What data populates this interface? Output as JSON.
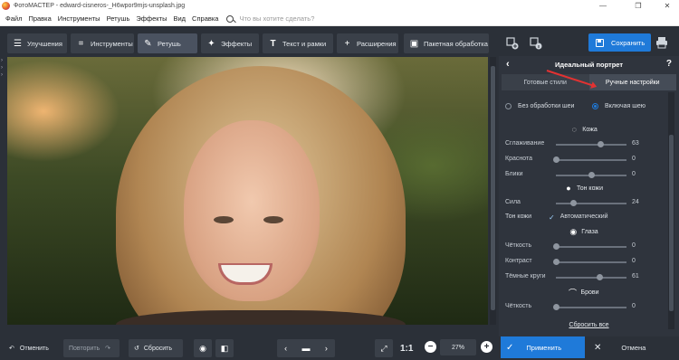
{
  "window": {
    "title": "ФотоМАСТЕР - edward-cisneros-_H6wpor9mjs-unsplash.jpg",
    "controls": [
      "—",
      "❐",
      "✕"
    ]
  },
  "menu": {
    "items": [
      "Файл",
      "Правка",
      "Инструменты",
      "Ретушь",
      "Эффекты",
      "Вид",
      "Справка"
    ],
    "search_placeholder": "Что вы хотите сделать?"
  },
  "toolbar": {
    "tabs": [
      {
        "label": "Улучшения",
        "icon": "sliders-icon"
      },
      {
        "label": "Инструменты",
        "icon": "crop-icon"
      },
      {
        "label": "Ретушь",
        "icon": "brush-icon",
        "active": true
      },
      {
        "label": "Эффекты",
        "icon": "sparkle-icon"
      },
      {
        "label": "Текст и рамки",
        "icon": "text-icon"
      },
      {
        "label": "Расширения",
        "icon": "plus-icon"
      },
      {
        "label": "Пакетная обработка",
        "icon": "batch-icon"
      }
    ],
    "save_label": "Сохранить"
  },
  "panel": {
    "title": "Идеальный портрет",
    "tabs": [
      {
        "label": "Готовые стили"
      },
      {
        "label": "Ручные настройки",
        "active": true
      }
    ],
    "radio_none": "Без обработки шеи",
    "radio_include": "Включая шею",
    "sections": {
      "skin": "Кожа",
      "skin_tone": "Тон кожи",
      "eyes": "Глаза",
      "brows": "Брови"
    },
    "sliders": {
      "smoothing": {
        "label": "Сглаживание",
        "value": "63",
        "pos": 0.63
      },
      "redness": {
        "label": "Краснота",
        "value": "0",
        "pos": 0.0
      },
      "glare": {
        "label": "Блики",
        "value": "0",
        "pos": 0.5
      },
      "strength": {
        "label": "Сила",
        "value": "24",
        "pos": 0.24
      },
      "clarity_eyes": {
        "label": "Чёткость",
        "value": "0",
        "pos": 0.0
      },
      "contrast": {
        "label": "Контраст",
        "value": "0",
        "pos": 0.0
      },
      "dark_circles": {
        "label": "Тёмные круги",
        "value": "61",
        "pos": 0.61
      },
      "clarity_brows": {
        "label": "Чёткость",
        "value": "0",
        "pos": 0.0
      }
    },
    "skin_tone_label": "Тон кожи",
    "auto_label": "Автоматический",
    "reset_all": "Сбросить все"
  },
  "bottom": {
    "undo": "Отменить",
    "redo": "Повторить",
    "reset": "Сбросить",
    "ratio": "1:1",
    "zoom": "27%",
    "apply": "Применить",
    "cancel": "Отмена"
  },
  "colors": {
    "accent": "#1f7ad9",
    "arrow": "#e23232"
  }
}
